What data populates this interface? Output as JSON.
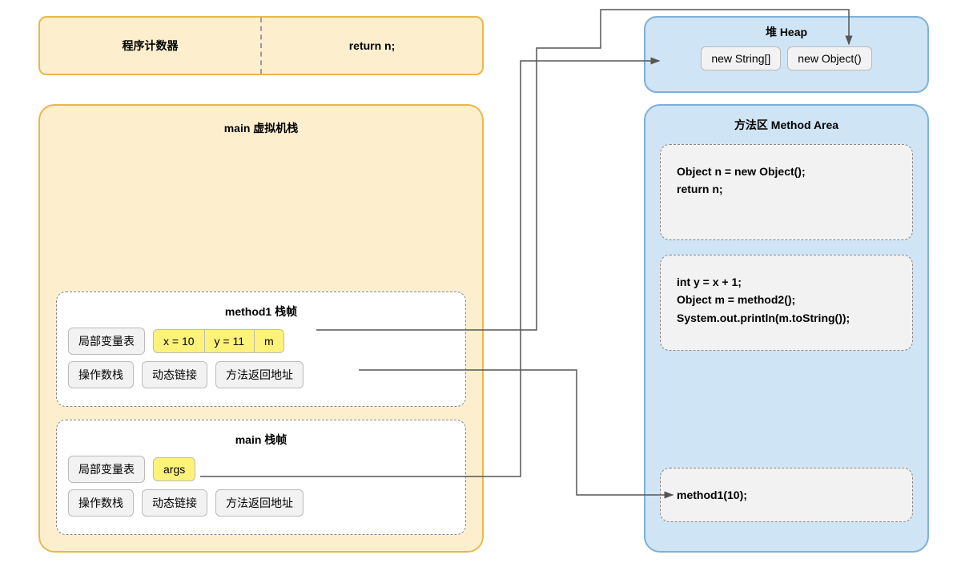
{
  "topbox": {
    "pc_label": "程序计数器",
    "return_stmt": "return n;"
  },
  "vmstack": {
    "title": "main 虚拟机栈",
    "frames": [
      {
        "title": "method1 栈帧",
        "locals_label": "局部变量表",
        "slots": [
          "x = 10",
          "y = 11",
          "m"
        ],
        "operand_stack": "操作数栈",
        "dynamic_link": "动态链接",
        "return_addr": "方法返回地址"
      },
      {
        "title": "main 栈帧",
        "locals_label": "局部变量表",
        "slots": [
          "args"
        ],
        "operand_stack": "操作数栈",
        "dynamic_link": "动态链接",
        "return_addr": "方法返回地址"
      }
    ]
  },
  "heap": {
    "title": "堆 Heap",
    "objects": [
      "new String[]",
      "new Object()"
    ]
  },
  "method_area": {
    "title": "方法区 Method Area",
    "blocks": [
      "Object n = new Object();\nreturn n;",
      "int y = x + 1;\nObject m = method2();\nSystem.out.println(m.toString());",
      "method1(10);"
    ]
  }
}
